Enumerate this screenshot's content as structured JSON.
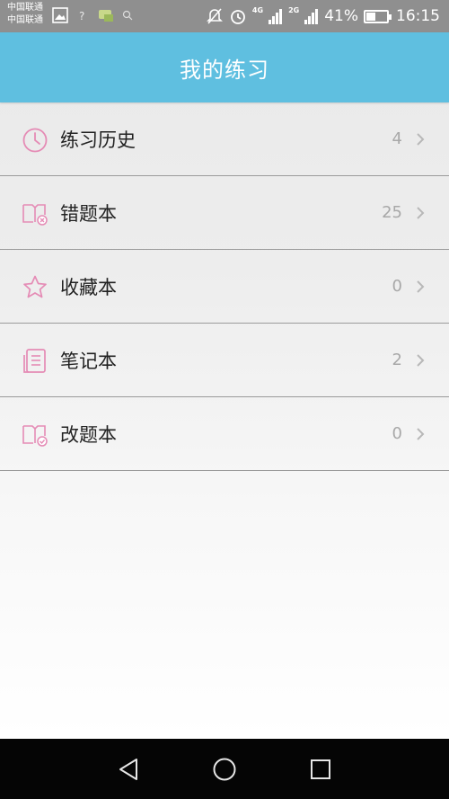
{
  "status_bar": {
    "carrier_1": "中国联通",
    "carrier_2": "中国联通",
    "net_1": "4G",
    "net_2": "2G",
    "battery_text": "41%",
    "battery_level": 0.41,
    "time": "16:15"
  },
  "header": {
    "title": "我的练习"
  },
  "list": {
    "items": [
      {
        "label": "练习历史",
        "count": "4",
        "icon": "clock-icon"
      },
      {
        "label": "错题本",
        "count": "25",
        "icon": "wrong-book-icon"
      },
      {
        "label": "收藏本",
        "count": "0",
        "icon": "star-icon"
      },
      {
        "label": "笔记本",
        "count": "2",
        "icon": "notebook-icon"
      },
      {
        "label": "改题本",
        "count": "0",
        "icon": "corrected-book-icon"
      }
    ]
  },
  "colors": {
    "header_bg": "#5fbfe0",
    "icon_accent": "#e58bb5",
    "status_bar_bg": "#8f8f8f",
    "nav_bar_bg": "#050505"
  }
}
